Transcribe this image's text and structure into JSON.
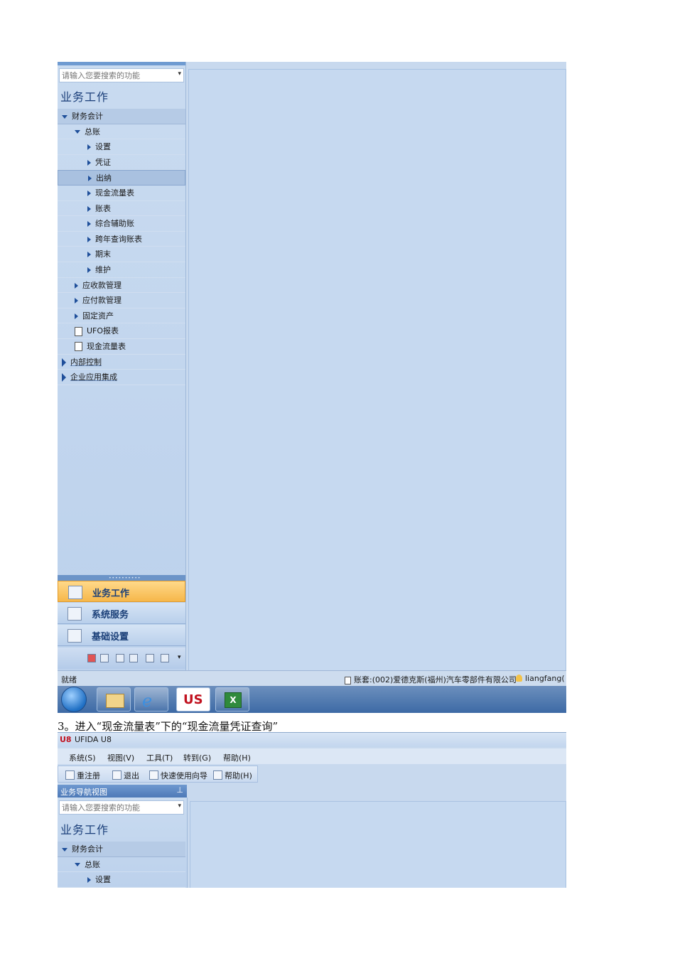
{
  "shot1": {
    "search_placeholder": "请输入您要搜索的功能",
    "nav_title": "业务工作",
    "tree": [
      {
        "label": "财务会计",
        "level": 0,
        "marker": "down",
        "category": true
      },
      {
        "label": "总账",
        "level": 1,
        "marker": "down"
      },
      {
        "label": "设置",
        "level": 2,
        "marker": "right"
      },
      {
        "label": "凭证",
        "level": 2,
        "marker": "right"
      },
      {
        "label": "出纳",
        "level": 2,
        "marker": "right",
        "selected": true
      },
      {
        "label": "现金流量表",
        "level": 2,
        "marker": "right"
      },
      {
        "label": "账表",
        "level": 2,
        "marker": "right"
      },
      {
        "label": "综合辅助账",
        "level": 2,
        "marker": "right"
      },
      {
        "label": "跨年查询账表",
        "level": 2,
        "marker": "right"
      },
      {
        "label": "期末",
        "level": 2,
        "marker": "right"
      },
      {
        "label": "维护",
        "level": 2,
        "marker": "right"
      },
      {
        "label": "应收款管理",
        "level": 1,
        "marker": "right"
      },
      {
        "label": "应付款管理",
        "level": 1,
        "marker": "right"
      },
      {
        "label": "固定资产",
        "level": 1,
        "marker": "right"
      },
      {
        "label": "UFO报表",
        "level": 1,
        "marker": "doc"
      },
      {
        "label": "现金流量表",
        "level": 1,
        "marker": "doc"
      },
      {
        "label": "内部控制",
        "level": 0,
        "marker": "bigright",
        "link": true
      },
      {
        "label": "企业应用集成",
        "level": 0,
        "marker": "bigright",
        "link": true
      }
    ],
    "modules": [
      {
        "label": "业务工作",
        "active": true,
        "icon": "chart-icon"
      },
      {
        "label": "系统服务",
        "active": false,
        "icon": "monitor-icon"
      },
      {
        "label": "基础设置",
        "active": false,
        "icon": "gear-icon"
      }
    ],
    "status_ready": "就绪",
    "status_account": "账套:(002)爱德克斯(福州)汽车零部件有限公司",
    "status_user": "liangfang(",
    "taskbar_items": [
      "start-orb-icon",
      "folder-icon",
      "ie-icon",
      "u8-icon",
      "excel-icon"
    ]
  },
  "caption": "3。进入“现金流量表”下的“现金流量凭证查询”",
  "shot2": {
    "window_title": "UFIDA U8",
    "logo": "U8",
    "menu": [
      "系统(S)",
      "视图(V)",
      "工具(T)",
      "转到(G)",
      "帮助(H)"
    ],
    "toolbar": [
      "重注册",
      "退出",
      "快速使用向导",
      "帮助(H)"
    ],
    "pane_title": "业务导航视图",
    "search_placeholder": "请输入您要搜索的功能",
    "nav_title": "业务工作",
    "tree": [
      {
        "label": "财务会计",
        "level": 0,
        "marker": "down",
        "category": true
      },
      {
        "label": "总账",
        "level": 1,
        "marker": "down"
      },
      {
        "label": "设置",
        "level": 2,
        "marker": "right"
      }
    ]
  },
  "colors": {
    "accent": "#f6b74a",
    "panel": "#c6d9f0",
    "nav_blue": "#6c94c8"
  }
}
